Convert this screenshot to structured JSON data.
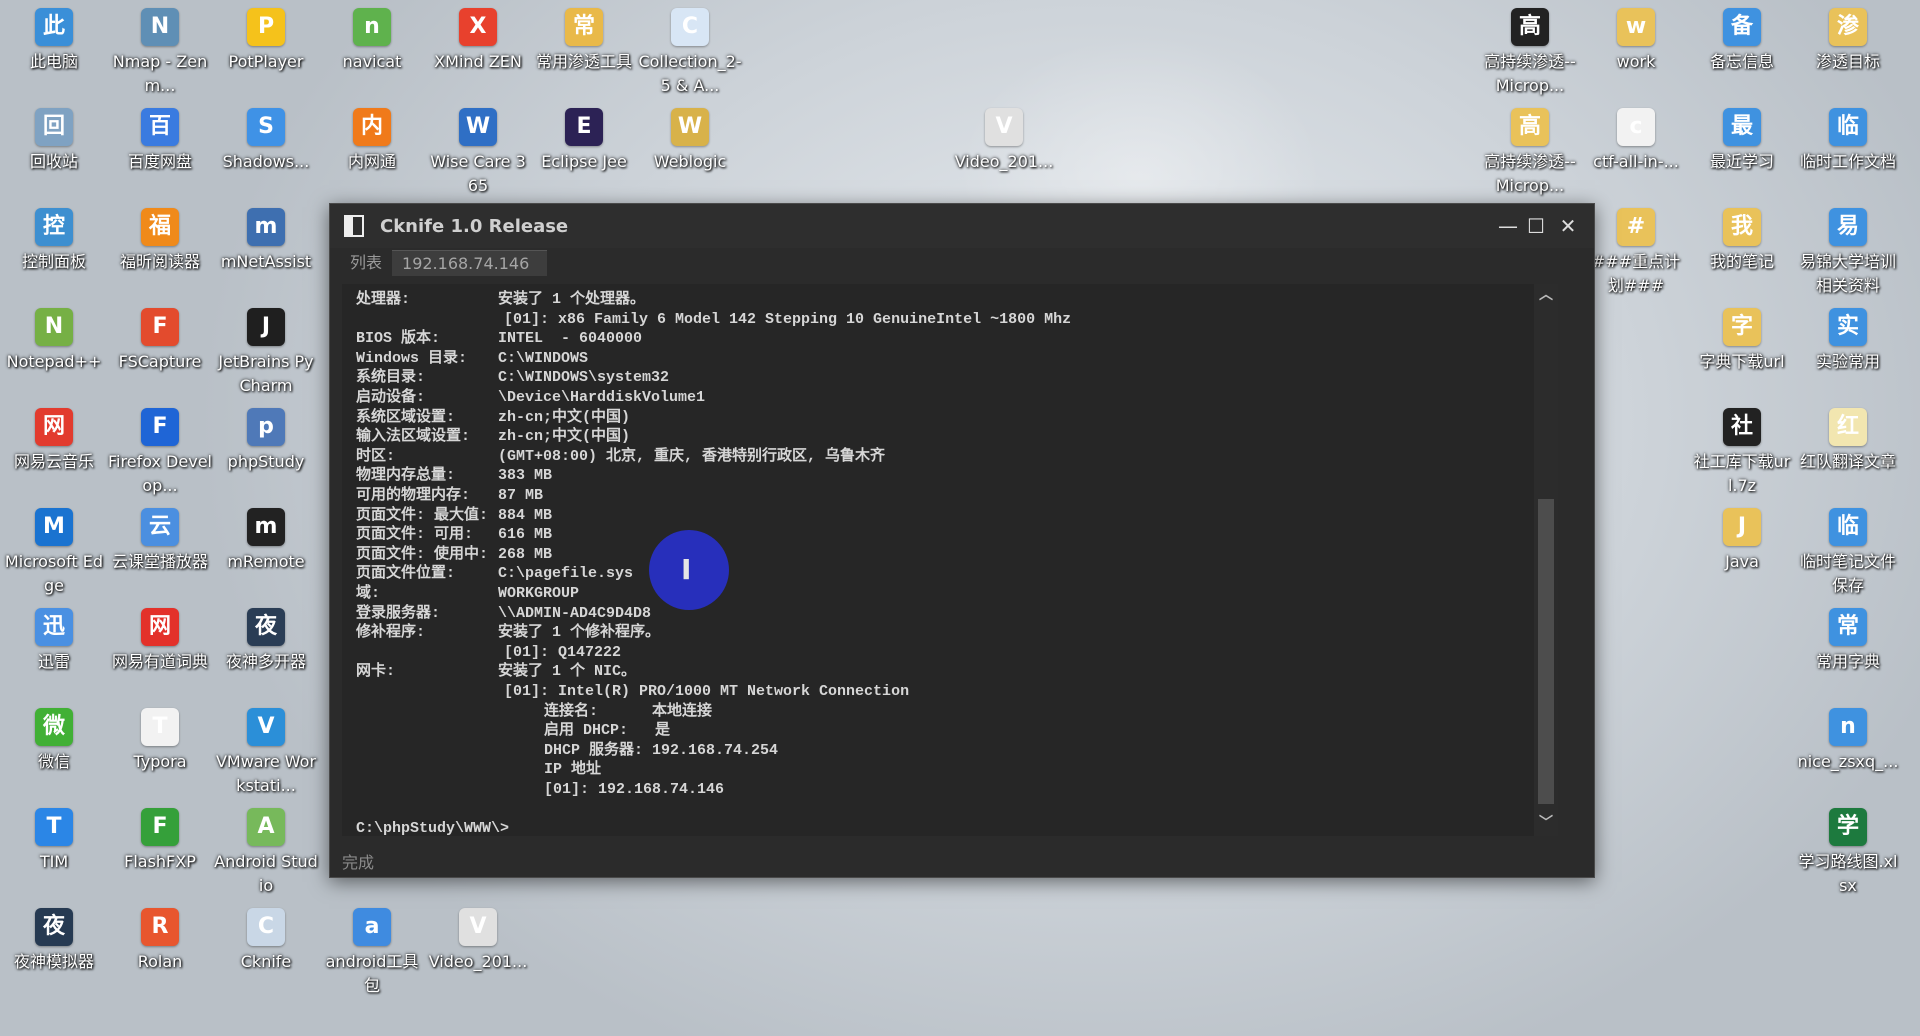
{
  "desktop": {
    "icons": [
      {
        "label": "此电脑",
        "icon": "computer-icon",
        "color": "#3a8fd8"
      },
      {
        "label": "Nmap - Zenm...",
        "icon": "nmap-eye-icon",
        "color": "#5f8fb5"
      },
      {
        "label": "PotPlayer",
        "icon": "potplayer-icon",
        "color": "#f5c21b"
      },
      {
        "label": "navicat",
        "icon": "navicat-icon",
        "color": "#5fb24d"
      },
      {
        "label": "XMind ZEN",
        "icon": "xmind-icon",
        "color": "#e8412d"
      },
      {
        "label": "常用渗透工具",
        "icon": "folder-icon",
        "color": "#e9b949"
      },
      {
        "label": "Collection_2-5 & A...",
        "icon": "file-icon",
        "color": "#d8e6f5"
      },
      {
        "label": "回收站",
        "icon": "recycle-bin-icon",
        "color": "#7fa2c2"
      },
      {
        "label": "百度网盘",
        "icon": "baidu-netdisk-icon",
        "color": "#3a7be0"
      },
      {
        "label": "Shadows...",
        "icon": "shadowsocks-icon",
        "color": "#3f92e6"
      },
      {
        "label": "内网通",
        "icon": "neiwangtong-icon",
        "color": "#f07a1a"
      },
      {
        "label": "Wise Care 365",
        "icon": "wise-care-icon",
        "color": "#2f6fc5"
      },
      {
        "label": "Eclipse Jee",
        "icon": "eclipse-icon",
        "color": "#2c2255"
      },
      {
        "label": "Weblogic",
        "icon": "weblogic-icon",
        "color": "#d8b24a"
      },
      {
        "label": "Video_201...",
        "icon": "video-file-icon",
        "color": "#e0e0e0"
      },
      {
        "label": "控制面板",
        "icon": "control-panel-icon",
        "color": "#3d8fd0"
      },
      {
        "label": "福昕阅读器",
        "icon": "foxit-reader-icon",
        "color": "#f08a1a"
      },
      {
        "label": "mNetAssist",
        "icon": "mnetassist-icon",
        "color": "#3e6fb0"
      },
      {
        "label": "Notepad++",
        "icon": "notepadpp-icon",
        "color": "#76b045"
      },
      {
        "label": "FSCapture",
        "icon": "fscapture-icon",
        "color": "#e34b2d"
      },
      {
        "label": "JetBrains PyCharm",
        "icon": "pycharm-icon",
        "color": "#1f1f1f"
      },
      {
        "label": "网易云音乐",
        "icon": "netease-music-icon",
        "color": "#e23b2e"
      },
      {
        "label": "Firefox Develop...",
        "icon": "firefox-dev-icon",
        "color": "#1f65d6"
      },
      {
        "label": "phpStudy",
        "icon": "phpstudy-icon",
        "color": "#4f79b8"
      },
      {
        "label": "Microsoft Edge",
        "icon": "edge-icon",
        "color": "#1a73d0"
      },
      {
        "label": "云课堂播放器",
        "icon": "cloud-class-player-icon",
        "color": "#4b8fe0"
      },
      {
        "label": "mRemote",
        "icon": "mremote-icon",
        "color": "#222222"
      },
      {
        "label": "迅雷",
        "icon": "xunlei-icon",
        "color": "#4a90e2"
      },
      {
        "label": "网易有道词典",
        "icon": "youdao-dict-icon",
        "color": "#e3312a"
      },
      {
        "label": "夜神多开器",
        "icon": "nox-multi-icon",
        "color": "#2a3d55"
      },
      {
        "label": "微信",
        "icon": "wechat-icon",
        "color": "#41b035"
      },
      {
        "label": "Typora",
        "icon": "typora-icon",
        "color": "#f2f2f2"
      },
      {
        "label": "VMware Workstati...",
        "icon": "vmware-icon",
        "color": "#2b8fd8"
      },
      {
        "label": "TIM",
        "icon": "tim-icon",
        "color": "#2b86e6"
      },
      {
        "label": "FlashFXP",
        "icon": "flashfxp-icon",
        "color": "#35a03a"
      },
      {
        "label": "Android Studio",
        "icon": "android-studio-icon",
        "color": "#77b95b"
      },
      {
        "label": "夜神模拟器",
        "icon": "nox-player-icon",
        "color": "#263a52"
      },
      {
        "label": "Rolan",
        "icon": "rolan-icon",
        "color": "#e8562e"
      },
      {
        "label": "Cknife",
        "icon": "cknife-icon",
        "color": "#c9d7e6"
      },
      {
        "label": "android工具包",
        "icon": "android-tools-folder-icon",
        "color": "#3f8be0"
      },
      {
        "label": "Video_201...",
        "icon": "video-file-icon",
        "color": "#e0e0e0"
      },
      {
        "label": "高持续渗透--Microp...",
        "icon": "7z-archive-icon",
        "color": "#222222"
      },
      {
        "label": "work",
        "icon": "folder-icon",
        "color": "#e9c25a"
      },
      {
        "label": "备忘信息",
        "icon": "folder-blue-icon",
        "color": "#3f92e0"
      },
      {
        "label": "渗透目标",
        "icon": "folder-icon",
        "color": "#e9c25a"
      },
      {
        "label": "高持续渗透--Microp...",
        "icon": "folder-icon",
        "color": "#e9c25a"
      },
      {
        "label": "ctf-all-in-...",
        "icon": "folder-icon",
        "color": "#f2f2f2"
      },
      {
        "label": "最近学习",
        "icon": "folder-blue-icon",
        "color": "#3f92e0"
      },
      {
        "label": "临时工作文档",
        "icon": "folder-blue-icon",
        "color": "#3f92e0"
      },
      {
        "label": "###重点计划###",
        "icon": "folder-icon",
        "color": "#e9c25a"
      },
      {
        "label": "我的笔记",
        "icon": "folder-icon",
        "color": "#e9c25a"
      },
      {
        "label": "易锦大学培训相关资料",
        "icon": "folder-blue-icon",
        "color": "#3f92e0"
      },
      {
        "label": "字典下载url",
        "icon": "folder-icon",
        "color": "#e9c25a"
      },
      {
        "label": "实验常用",
        "icon": "globe-folder-icon",
        "color": "#3f92e0"
      },
      {
        "label": "社工库下载url.7z",
        "icon": "7z-archive-icon",
        "color": "#222222"
      },
      {
        "label": "红队翻译文章",
        "icon": "folder-icon",
        "color": "#f2e6b0"
      },
      {
        "label": "Java",
        "icon": "folder-icon",
        "color": "#e9c25a"
      },
      {
        "label": "临时笔记文件保存",
        "icon": "folder-blue-icon",
        "color": "#3f92e0"
      },
      {
        "label": "常用字典",
        "icon": "folder-star-icon",
        "color": "#3f92e0"
      },
      {
        "label": "nice_zsxq_...",
        "icon": "folder-star-icon",
        "color": "#3f92e0"
      },
      {
        "label": "学习路线图.xlsx",
        "icon": "excel-file-icon",
        "color": "#1d7a3e"
      }
    ]
  },
  "window": {
    "title": "Cknife 1.0 Release",
    "controls": {
      "minimize": "—",
      "maximize": "☐",
      "close": "✕"
    },
    "tabs": [
      {
        "label": "列表",
        "active": false
      },
      {
        "label": "192.168.74.146",
        "active": true
      }
    ],
    "console_lines": [
      {
        "key": "处理器:",
        "value": "安装了 1 个处理器。"
      },
      {
        "key": "",
        "value": "[01]: x86 Family 6 Model 142 Stepping 10 GenuineIntel ~1800 Mhz"
      },
      {
        "key": "BIOS 版本:",
        "value": "INTEL  - 6040000"
      },
      {
        "key": "Windows 目录:",
        "value": "C:\\WINDOWS"
      },
      {
        "key": "系统目录:",
        "value": "C:\\WINDOWS\\system32"
      },
      {
        "key": "启动设备:",
        "value": "\\Device\\HarddiskVolume1"
      },
      {
        "key": "系统区域设置:",
        "value": "zh-cn;中文(中国)"
      },
      {
        "key": "输入法区域设置:",
        "value": "zh-cn;中文(中国)"
      },
      {
        "key": "时区:",
        "value": "(GMT+08:00) 北京, 重庆, 香港特别行政区, 乌鲁木齐"
      },
      {
        "key": "物理内存总量:",
        "value": "383 MB"
      },
      {
        "key": "可用的物理内存:",
        "value": "87 MB"
      },
      {
        "key": "页面文件: 最大值:",
        "value": "884 MB"
      },
      {
        "key": "页面文件: 可用:",
        "value": "616 MB"
      },
      {
        "key": "页面文件: 使用中:",
        "value": "268 MB"
      },
      {
        "key": "页面文件位置:",
        "value": "C:\\pagefile.sys"
      },
      {
        "key": "域:",
        "value": "WORKGROUP"
      },
      {
        "key": "登录服务器:",
        "value": "\\\\ADMIN-AD4C9D4D8"
      },
      {
        "key": "修补程序:",
        "value": "安装了 1 个修补程序。"
      },
      {
        "key": "",
        "value": "[01]: Q147222"
      },
      {
        "key": "网卡:",
        "value": "安装了 1 个 NIC。"
      },
      {
        "key": "",
        "value": "[01]: Intel(R) PRO/1000 MT Network Connection"
      },
      {
        "key": "",
        "value": "连接名:      本地连接"
      },
      {
        "key": "",
        "value": "启用 DHCP:   是"
      },
      {
        "key": "",
        "value": "DHCP 服务器: 192.168.74.254"
      },
      {
        "key": "",
        "value": "IP 地址"
      },
      {
        "key": "",
        "value": "[01]: 192.168.74.146"
      },
      {
        "key": "",
        "value": ""
      },
      {
        "key": "C:\\phpStudy\\WWW\\>",
        "value": ""
      }
    ],
    "status": "完成"
  }
}
